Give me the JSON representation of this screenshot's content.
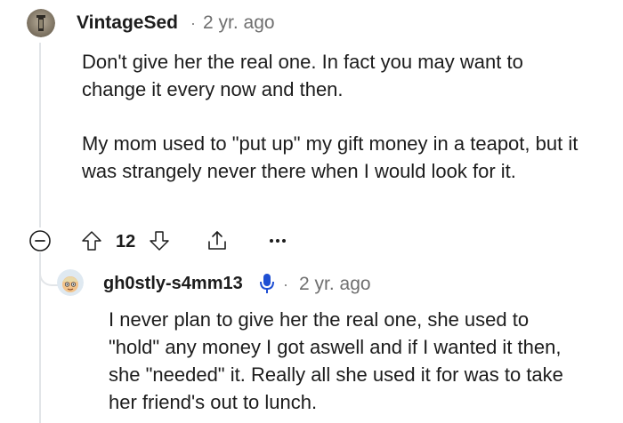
{
  "comment": {
    "username": "VintageSed",
    "separator": "·",
    "time": "2 yr. ago",
    "paragraphs": [
      "Don't give her the real one. In fact you may want to change it every now and then.",
      "My mom used to \"put up\" my gift money in a teapot, but it was strangely never there when I would look for it."
    ],
    "votes": "12",
    "icons": [
      "collapse-icon",
      "upvote-icon",
      "downvote-icon",
      "share-icon",
      "more-options-icon"
    ]
  },
  "reply": {
    "username": "gh0stly-s4mm13",
    "badge_icon": "microphone-icon",
    "badge_color": "#1e4fd3",
    "separator": "·",
    "time": "2 yr. ago",
    "paragraphs": [
      "I never plan to give her the real one, she used to \"hold\" any money I got aswell and if I wanted it then, she \"needed\" it. Really all she used it for was to take her friend's out to lunch."
    ]
  }
}
